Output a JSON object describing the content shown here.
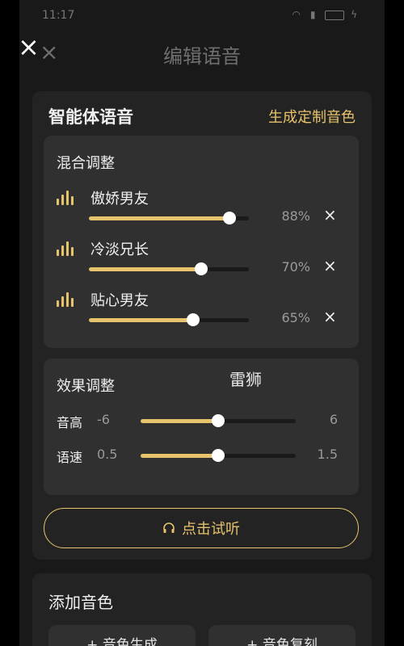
{
  "status_bar": {
    "time": "11:17"
  },
  "header": {
    "title": "编辑语音",
    "close_glyph": "×"
  },
  "overlay": {
    "close_glyph": "×"
  },
  "agent_voice": {
    "title": "智能体语音",
    "custom_link": "生成定制音色",
    "mix": {
      "title": "混合调整",
      "items": [
        {
          "name": "傲娇男友",
          "percent_label": "88%",
          "value": 0.88,
          "remove": "×"
        },
        {
          "name": "冷淡兄长",
          "percent_label": "70%",
          "value": 0.7,
          "remove": "×"
        },
        {
          "name": "贴心男友",
          "percent_label": "65%",
          "value": 0.65,
          "remove": "×"
        }
      ]
    },
    "effect": {
      "title": "效果调整",
      "watermark": "雷狮",
      "pitch": {
        "label": "音高",
        "min": "-6",
        "max": "6",
        "value": 0.5
      },
      "speed": {
        "label": "语速",
        "min": "0.5",
        "max": "1.5",
        "value": 0.5
      }
    },
    "listen_button": "点击试听"
  },
  "add_voice": {
    "title": "添加音色",
    "buttons": [
      "+ 音色生成",
      "+ 音色复刻"
    ]
  },
  "colors": {
    "accent": "#e6c36c",
    "background": "#191919",
    "card": "#232323",
    "subcard": "#303030"
  }
}
